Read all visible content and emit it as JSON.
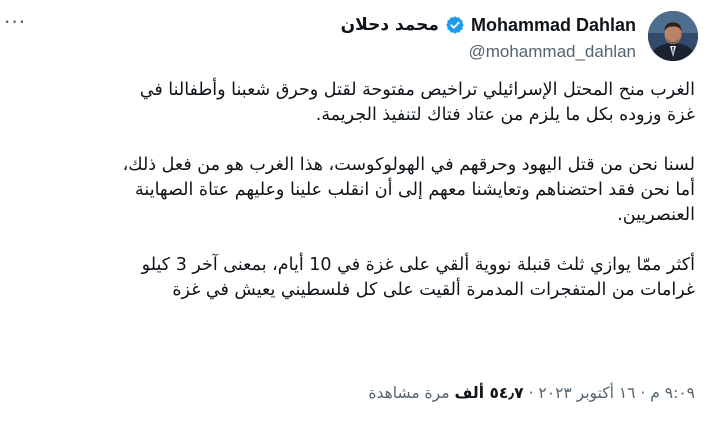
{
  "header": {
    "display_name_latin": "Mohammad Dahlan",
    "display_name_arabic": "محمد دحلان",
    "handle": "@mohammad_dahlan",
    "more_label": "···",
    "verified_color": "#1d9bf0",
    "icons": {
      "more": "more-icon",
      "verified": "verified-badge-icon",
      "avatar": "profile-photo"
    }
  },
  "tweet": {
    "paragraphs": [
      "الغرب منح المحتل الإسرائيلي تراخيص مفتوحة لقتل وحرق شعبنا وأطفالنا في\nغزة وزوده بكل ما يلزم من عتاد فتاك لتنفيذ الجريمة.",
      "لسنا نحن من قتل اليهود وحرقهم في الهولوكوست، هذا الغرب هو من فعل ذلك،\nأما نحن فقد احتضناهم وتعايشنا معهم إلى أن انقلب علينا وعليهم عتاة الصهاينة\nالعنصريين.",
      "أكثر ممّا يوازي ثلث قنبلة نووية ألقي على غزة في 10 أيام، بمعنى آخر 3 كيلو\nغرامات من المتفجرات المدمرة ألقيت على كل فلسطيني يعيش في غزة"
    ]
  },
  "meta": {
    "time_date": "٩:٠٩ م · ١٦ أكتوبر ٢٠٢٣ · ",
    "views_count": "٥٤٫٧ ألف",
    "views_label": " مرة مشاهدة"
  }
}
